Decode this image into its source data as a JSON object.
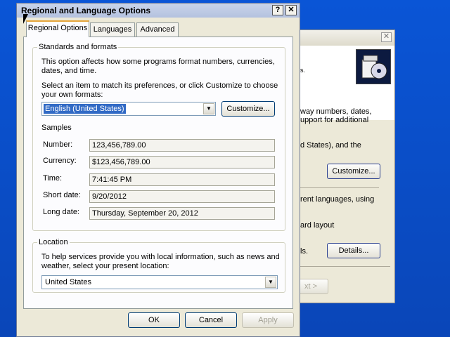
{
  "main_window": {
    "title": "Regional and Language Options",
    "help_label": "?",
    "close_label": "✕"
  },
  "tabs": [
    {
      "label": "Regional Options",
      "active": true
    },
    {
      "label": "Languages",
      "active": false
    },
    {
      "label": "Advanced",
      "active": false
    }
  ],
  "standards": {
    "legend": "Standards and formats",
    "description": "This option affects how some programs format numbers, currencies, dates, and time.",
    "description_line1": "This option affects how some programs format numbers, currencies,",
    "description_line2": "dates, and time.",
    "select_line1": "Select an item to match its preferences, or click Customize to choose",
    "select_line2": "your own formats:",
    "selected_format": "English (United States)",
    "customize_label": "Customize...",
    "samples_label": "Samples",
    "samples": [
      {
        "label": "Number:",
        "value": "123,456,789.00"
      },
      {
        "label": "Currency:",
        "value": "$123,456,789.00"
      },
      {
        "label": "Time:",
        "value": "7:41:45 PM"
      },
      {
        "label": "Short date:",
        "value": "9/20/2012"
      },
      {
        "label": "Long date:",
        "value": "Thursday, September 20, 2012"
      }
    ]
  },
  "location": {
    "legend": "Location",
    "line1": "To help services provide you with local information, such as news and",
    "line2": "weather, select your present location:",
    "selected": "United States"
  },
  "footer": {
    "ok_label": "OK",
    "cancel_label": "Cancel",
    "apply_label": "Apply"
  },
  "back_window": {
    "fragments": [
      "s.",
      "way numbers, dates,",
      "upport for additional",
      "d States), and the",
      "rent languages, using",
      "ard layout",
      "ls."
    ],
    "customize_label": "Customize...",
    "details_label": "Details...",
    "next_label": "xt >",
    "close_label": "✕"
  },
  "colors": {
    "desktop": "#0a4fc9",
    "window_bg": "#ece9d8",
    "selection": "#316ac5"
  }
}
